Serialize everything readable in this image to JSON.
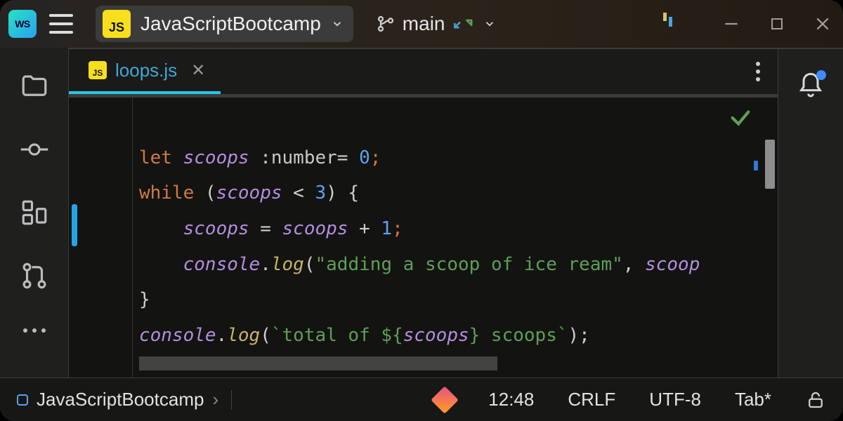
{
  "titlebar": {
    "app_icon_text": "WS",
    "project_badge": "JS",
    "project_name": "JavaScriptBootcamp",
    "branch_name": "main"
  },
  "tabs": {
    "file_badge": "JS",
    "file_name": "loops.js"
  },
  "code": {
    "l1_kw": "let ",
    "l1_var": "scoops",
    "l1_type": " :number",
    "l1_eq": "= ",
    "l1_num": "0",
    "l1_sc": ";",
    "l2_kw": "while ",
    "l2_po": "(",
    "l2_var": "scoops",
    "l2_op": " < ",
    "l2_num": "3",
    "l2_pc": ") {",
    "l3_var": "scoops",
    "l3_eq": " = ",
    "l3_var2": "scoops",
    "l3_op": " + ",
    "l3_num": "1",
    "l3_sc": ";",
    "l4_obj": "console",
    "l4_dot": ".",
    "l4_fn": "log",
    "l4_po": "(",
    "l4_str": "\"adding a scoop of ice ream\"",
    "l4_cm": ", ",
    "l4_var": "scoop",
    "l5_close": "}",
    "l6_obj": "console",
    "l6_dot": ".",
    "l6_fn": "log",
    "l6_po": "(",
    "l6_tpl1": "`total of ${",
    "l6_var": "scoops",
    "l6_tpl2": "} scoops`",
    "l6_pc": ");"
  },
  "status": {
    "project": "JavaScriptBootcamp",
    "chevron": "›",
    "cursor": "12:48",
    "line_sep": "CRLF",
    "encoding": "UTF-8",
    "indent": "Tab*"
  }
}
